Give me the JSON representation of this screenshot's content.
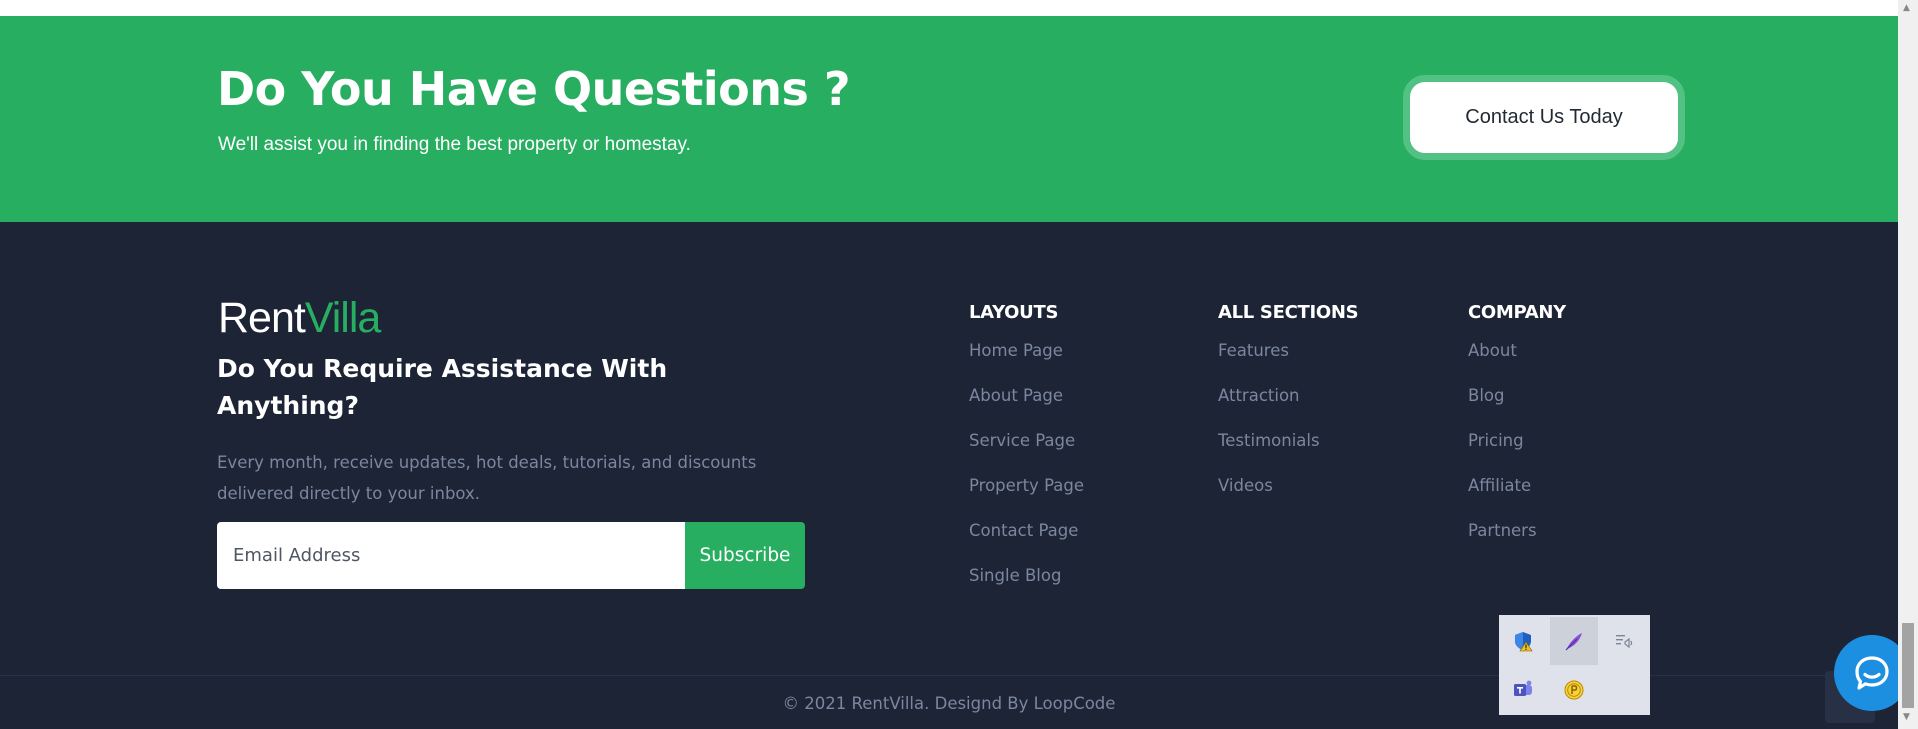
{
  "cta": {
    "title": "Do You Have Questions ?",
    "subtitle": "We'll assist you in finding the best property or homestay.",
    "button_label": "Contact Us Today"
  },
  "footer": {
    "logo": {
      "part1": "Rent",
      "part2": "Villa"
    },
    "heading": "Do You Require Assistance With Anything?",
    "description": "Every month, receive updates, hot deals, tutorials, and discounts delivered directly to your inbox.",
    "email_placeholder": "Email Address",
    "subscribe_label": "Subscribe",
    "columns": [
      {
        "title": "LAYOUTS",
        "links": [
          "Home Page",
          "About Page",
          "Service Page",
          "Property Page",
          "Contact Page",
          "Single Blog"
        ]
      },
      {
        "title": "ALL SECTIONS",
        "links": [
          "Features",
          "Attraction",
          "Testimonials",
          "Videos"
        ]
      },
      {
        "title": "COMPANY",
        "links": [
          "About",
          "Blog",
          "Pricing",
          "Affiliate",
          "Partners"
        ]
      }
    ],
    "copyright": "© 2021 RentVilla. Designd By LoopCode"
  },
  "colors": {
    "green": "#28ae60",
    "dark_navy": "#1d2436",
    "muted_text": "#7b879e",
    "chat_blue": "#1d8fe0"
  },
  "icons": {
    "chat": "chat-bubble-icon",
    "tray": [
      "shield-warning-icon",
      "feather-pen-icon",
      "notification-icon",
      "teams-icon",
      "coin-icon"
    ]
  }
}
